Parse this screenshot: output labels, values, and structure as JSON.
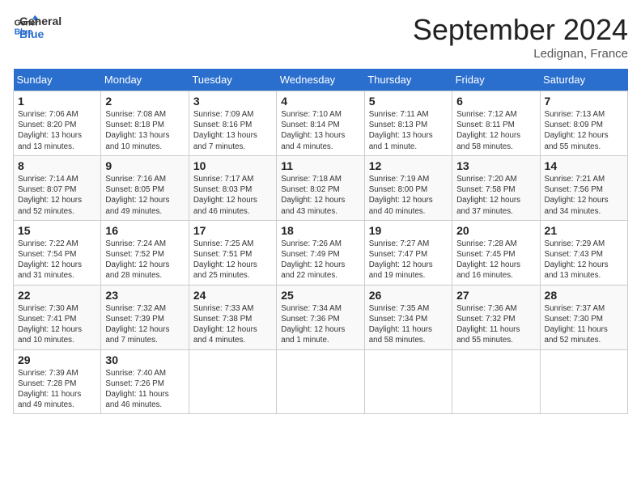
{
  "header": {
    "logo_line1": "General",
    "logo_line2": "Blue",
    "month_title": "September 2024",
    "location": "Ledignan, France"
  },
  "days_of_week": [
    "Sunday",
    "Monday",
    "Tuesday",
    "Wednesday",
    "Thursday",
    "Friday",
    "Saturday"
  ],
  "weeks": [
    [
      {
        "day": "1",
        "text": "Sunrise: 7:06 AM\nSunset: 8:20 PM\nDaylight: 13 hours\nand 13 minutes."
      },
      {
        "day": "2",
        "text": "Sunrise: 7:08 AM\nSunset: 8:18 PM\nDaylight: 13 hours\nand 10 minutes."
      },
      {
        "day": "3",
        "text": "Sunrise: 7:09 AM\nSunset: 8:16 PM\nDaylight: 13 hours\nand 7 minutes."
      },
      {
        "day": "4",
        "text": "Sunrise: 7:10 AM\nSunset: 8:14 PM\nDaylight: 13 hours\nand 4 minutes."
      },
      {
        "day": "5",
        "text": "Sunrise: 7:11 AM\nSunset: 8:13 PM\nDaylight: 13 hours\nand 1 minute."
      },
      {
        "day": "6",
        "text": "Sunrise: 7:12 AM\nSunset: 8:11 PM\nDaylight: 12 hours\nand 58 minutes."
      },
      {
        "day": "7",
        "text": "Sunrise: 7:13 AM\nSunset: 8:09 PM\nDaylight: 12 hours\nand 55 minutes."
      }
    ],
    [
      {
        "day": "8",
        "text": "Sunrise: 7:14 AM\nSunset: 8:07 PM\nDaylight: 12 hours\nand 52 minutes."
      },
      {
        "day": "9",
        "text": "Sunrise: 7:16 AM\nSunset: 8:05 PM\nDaylight: 12 hours\nand 49 minutes."
      },
      {
        "day": "10",
        "text": "Sunrise: 7:17 AM\nSunset: 8:03 PM\nDaylight: 12 hours\nand 46 minutes."
      },
      {
        "day": "11",
        "text": "Sunrise: 7:18 AM\nSunset: 8:02 PM\nDaylight: 12 hours\nand 43 minutes."
      },
      {
        "day": "12",
        "text": "Sunrise: 7:19 AM\nSunset: 8:00 PM\nDaylight: 12 hours\nand 40 minutes."
      },
      {
        "day": "13",
        "text": "Sunrise: 7:20 AM\nSunset: 7:58 PM\nDaylight: 12 hours\nand 37 minutes."
      },
      {
        "day": "14",
        "text": "Sunrise: 7:21 AM\nSunset: 7:56 PM\nDaylight: 12 hours\nand 34 minutes."
      }
    ],
    [
      {
        "day": "15",
        "text": "Sunrise: 7:22 AM\nSunset: 7:54 PM\nDaylight: 12 hours\nand 31 minutes."
      },
      {
        "day": "16",
        "text": "Sunrise: 7:24 AM\nSunset: 7:52 PM\nDaylight: 12 hours\nand 28 minutes."
      },
      {
        "day": "17",
        "text": "Sunrise: 7:25 AM\nSunset: 7:51 PM\nDaylight: 12 hours\nand 25 minutes."
      },
      {
        "day": "18",
        "text": "Sunrise: 7:26 AM\nSunset: 7:49 PM\nDaylight: 12 hours\nand 22 minutes."
      },
      {
        "day": "19",
        "text": "Sunrise: 7:27 AM\nSunset: 7:47 PM\nDaylight: 12 hours\nand 19 minutes."
      },
      {
        "day": "20",
        "text": "Sunrise: 7:28 AM\nSunset: 7:45 PM\nDaylight: 12 hours\nand 16 minutes."
      },
      {
        "day": "21",
        "text": "Sunrise: 7:29 AM\nSunset: 7:43 PM\nDaylight: 12 hours\nand 13 minutes."
      }
    ],
    [
      {
        "day": "22",
        "text": "Sunrise: 7:30 AM\nSunset: 7:41 PM\nDaylight: 12 hours\nand 10 minutes."
      },
      {
        "day": "23",
        "text": "Sunrise: 7:32 AM\nSunset: 7:39 PM\nDaylight: 12 hours\nand 7 minutes."
      },
      {
        "day": "24",
        "text": "Sunrise: 7:33 AM\nSunset: 7:38 PM\nDaylight: 12 hours\nand 4 minutes."
      },
      {
        "day": "25",
        "text": "Sunrise: 7:34 AM\nSunset: 7:36 PM\nDaylight: 12 hours\nand 1 minute."
      },
      {
        "day": "26",
        "text": "Sunrise: 7:35 AM\nSunset: 7:34 PM\nDaylight: 11 hours\nand 58 minutes."
      },
      {
        "day": "27",
        "text": "Sunrise: 7:36 AM\nSunset: 7:32 PM\nDaylight: 11 hours\nand 55 minutes."
      },
      {
        "day": "28",
        "text": "Sunrise: 7:37 AM\nSunset: 7:30 PM\nDaylight: 11 hours\nand 52 minutes."
      }
    ],
    [
      {
        "day": "29",
        "text": "Sunrise: 7:39 AM\nSunset: 7:28 PM\nDaylight: 11 hours\nand 49 minutes."
      },
      {
        "day": "30",
        "text": "Sunrise: 7:40 AM\nSunset: 7:26 PM\nDaylight: 11 hours\nand 46 minutes."
      },
      null,
      null,
      null,
      null,
      null
    ]
  ]
}
